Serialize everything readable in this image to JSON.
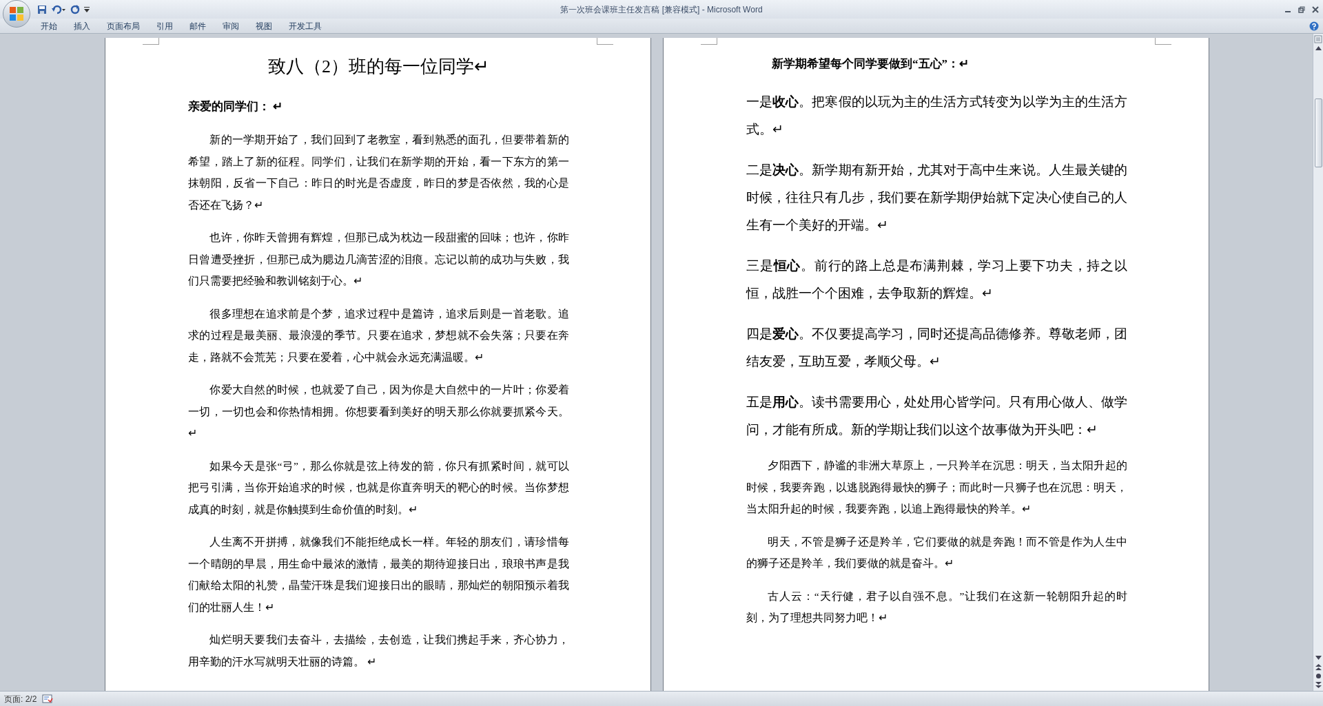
{
  "window": {
    "title": "第一次班会课班主任发言稿 [兼容模式] - Microsoft Word"
  },
  "ribbon_tabs": [
    {
      "label": "开始"
    },
    {
      "label": "插入"
    },
    {
      "label": "页面布局"
    },
    {
      "label": "引用"
    },
    {
      "label": "邮件"
    },
    {
      "label": "审阅"
    },
    {
      "label": "视图"
    },
    {
      "label": "开发工具"
    }
  ],
  "pages": [
    {
      "title": "致八（2）班的每一位同学↵",
      "blocks": [
        {
          "kind": "salutation",
          "text": "亲爱的同学们： ↵"
        },
        {
          "kind": "body",
          "text": "新的一学期开始了，我们回到了老教室，看到熟悉的面孔，但要带着新的希望，踏上了新的征程。同学们，让我们在新学期的开始，看一下东方的第一抹朝阳，反省一下自己：昨日的时光是否虚度，昨日的梦是否依然，我的心是否还在飞扬？↵"
        },
        {
          "kind": "body",
          "text": "也许，你昨天曾拥有辉煌，但那已成为枕边一段甜蜜的回味；也许，你昨日曾遭受挫折，但那已成为腮边几滴苦涩的泪痕。忘记以前的成功与失败，我们只需要把经验和教训铭刻于心。↵"
        },
        {
          "kind": "body",
          "text": "很多理想在追求前是个梦，追求过程中是篇诗，追求后则是一首老歌。追求的过程是最美丽、最浪漫的季节。只要在追求，梦想就不会失落；只要在奔走，路就不会荒芜；只要在爱着，心中就会永远充满温暖。↵"
        },
        {
          "kind": "body",
          "text": "你爱大自然的时候，也就爱了自己，因为你是大自然中的一片叶；你爱着一切，一切也会和你热情相拥。你想要看到美好的明天那么你就要抓紧今天。↵"
        },
        {
          "kind": "body",
          "text": "如果今天是张“弓”，那么你就是弦上待发的箭，你只有抓紧时间，就可以把弓引满，当你开始追求的时候，也就是你直奔明天的靶心的时候。当你梦想成真的时刻，就是你触摸到生命价值的时刻。↵"
        },
        {
          "kind": "body",
          "text": "人生离不开拼搏，就像我们不能拒绝成长一样。年轻的朋友们，请珍惜每一个晴朗的早晨，用生命中最浓的激情，最美的期待迎接日出，琅琅书声是我们献给太阳的礼赞，晶莹汗珠是我们迎接日出的眼睛，那灿烂的朝阳预示着我们的壮丽人生！↵"
        },
        {
          "kind": "body",
          "text": "灿烂明天要我们去奋斗，去描绘，去创造，让我们携起手来，齐心协力，用辛勤的汗水写就明天壮丽的诗篇。 ↵"
        }
      ]
    },
    {
      "blocks": [
        {
          "kind": "heading",
          "text": "新学期希望每个同学要做到“五心”：↵"
        },
        {
          "kind": "point",
          "text": "一是**收心**。把寒假的以玩为主的生活方式转变为以学为主的生活方式。↵"
        },
        {
          "kind": "point",
          "text": "二是**决心**。新学期有新开始，尤其对于高中生来说。人生最关键的时候，往往只有几步，我们要在新学期伊始就下定决心使自己的人生有一个美好的开端。↵"
        },
        {
          "kind": "point",
          "text": "三是**恒心**。前行的路上总是布满荆棘，学习上要下功夫，持之以恒，战胜一个个困难，去争取新的辉煌。↵"
        },
        {
          "kind": "point",
          "text": "四是**爱心**。不仅要提高学习，同时还提高品德修养。尊敬老师，团结友爱，互助互爱，孝顺父母。↵"
        },
        {
          "kind": "point",
          "text": "五是**用心**。读书需要用心，处处用心皆学问。只有用心做人、做学问，才能有所成。新的学期让我们以这个故事做为开头吧：↵"
        },
        {
          "kind": "body",
          "text": "夕阳西下，静谧的非洲大草原上，一只羚羊在沉思：明天，当太阳升起的时候，我要奔跑，以逃脱跑得最快的狮子；而此时一只狮子也在沉思：明天，当太阳升起的时候，我要奔跑，以追上跑得最快的羚羊。↵"
        },
        {
          "kind": "body",
          "text": "明天，不管是狮子还是羚羊，它们要做的就是奔跑！而不管是作为人生中的狮子还是羚羊，我们要做的就是奋斗。↵"
        },
        {
          "kind": "body",
          "text": "古人云：“天行健，君子以自强不息。”让我们在这新一轮朝阳升起的时刻，为了理想共同努力吧！↵"
        }
      ]
    }
  ],
  "status_bar": {
    "page": "页面: 2/2"
  }
}
